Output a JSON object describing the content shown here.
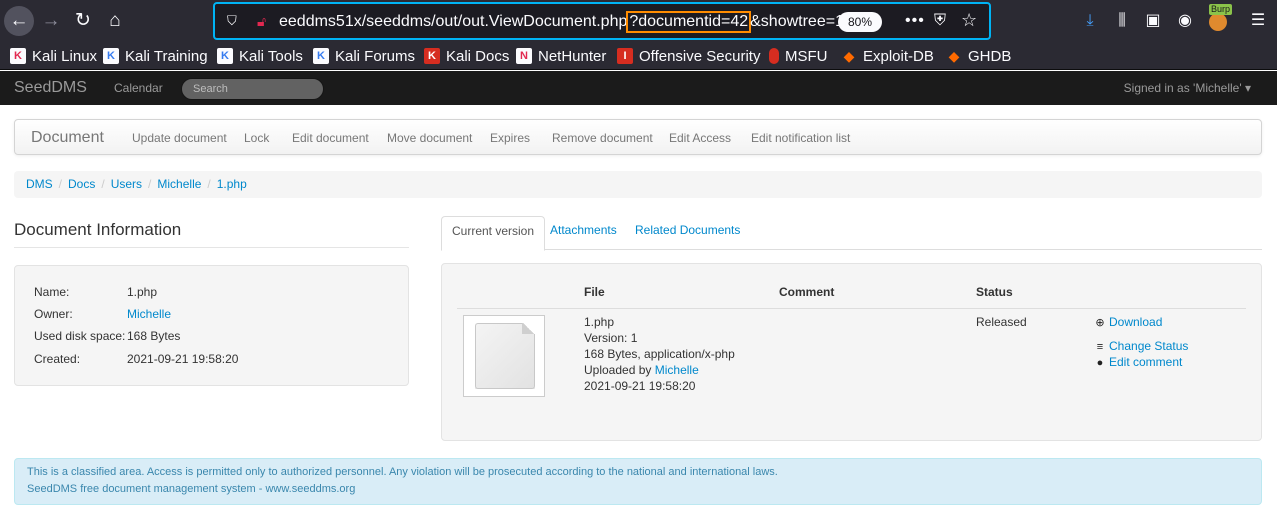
{
  "browser": {
    "url_before": "eeddms51x/seeddms/out/out.ViewDocument.php",
    "url_highlight": "?documentid=42",
    "url_after": "&showtree=1",
    "zoom": "80%",
    "more_icon": "•••",
    "burp_label": "Burp"
  },
  "bookmarks": [
    {
      "label": "Kali Linux"
    },
    {
      "label": "Kali Training"
    },
    {
      "label": "Kali Tools"
    },
    {
      "label": "Kali Forums"
    },
    {
      "label": "Kali Docs"
    },
    {
      "label": "NetHunter"
    },
    {
      "label": "Offensive Security"
    },
    {
      "label": "MSFU"
    },
    {
      "label": "Exploit-DB"
    },
    {
      "label": "GHDB"
    }
  ],
  "navbar": {
    "brand": "SeedDMS",
    "calendar": "Calendar",
    "search_placeholder": "Search",
    "signed_in": "Signed in as 'Michelle' ▾"
  },
  "doc_menu": {
    "title": "Document",
    "items": [
      "Update document",
      "Lock",
      "Edit document",
      "Move document",
      "Expires",
      "Remove document",
      "Edit Access",
      "Edit notification list"
    ]
  },
  "breadcrumb": [
    "DMS",
    "Docs",
    "Users",
    "Michelle",
    "1.php"
  ],
  "doc_info": {
    "title": "Document Information",
    "rows": [
      {
        "label": "Name:",
        "value": "1.php"
      },
      {
        "label": "Owner:",
        "value": "Michelle"
      },
      {
        "label": "Used disk space:",
        "value": "168 Bytes"
      },
      {
        "label": "Created:",
        "value": "2021-09-21 19:58:20"
      }
    ]
  },
  "tabs": [
    "Current version",
    "Attachments",
    "Related Documents"
  ],
  "version_table": {
    "headers": {
      "file": "File",
      "comment": "Comment",
      "status": "Status"
    },
    "file_name": "1.php",
    "version": "Version: 1",
    "size_type": "168 Bytes, application/x-php",
    "uploaded_by_prefix": "Uploaded by",
    "uploaded_by": "Michelle",
    "uploaded_date": "2021-09-21 19:58:20",
    "status": "Released",
    "actions": {
      "download": "Download",
      "change_status": "Change Status",
      "edit_comment": "Edit comment"
    }
  },
  "footer": {
    "line1": "This is a classified area. Access is permitted only to authorized personnel. Any violation will be prosecuted according to the national and international laws.",
    "line2": "SeedDMS free document management system - www.seeddms.org"
  }
}
